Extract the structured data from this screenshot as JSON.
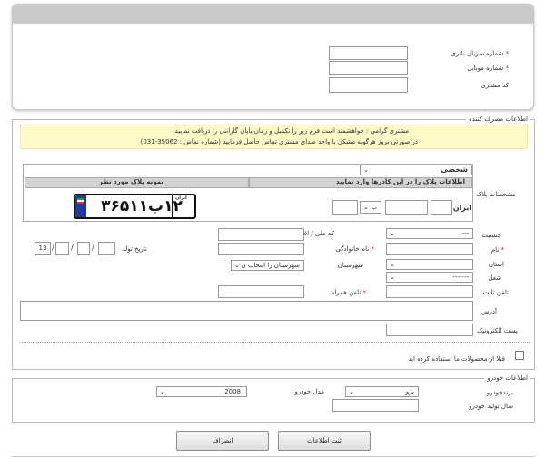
{
  "battery": {
    "serial_label": "شماره سریال باتری",
    "mobile_label": "شماره موبایل",
    "customer_code_label": "کد مشتری",
    "required_mark": "*"
  },
  "consumer": {
    "legend": "اطلاعات مصرف کننده",
    "notice_line1": "مشتری گرامی : خواهشمند است فرم زیر را تکمیل و زمان پایان گارانتی را دریافت نمایید",
    "notice_line2": "در صورتی بروز هرگونه مشکل با واحد صدای مشتری تماس حاصل فرمایید (شماره تماس : 35062-031)",
    "plate_label": "مشخصات پلاک",
    "plate_type": "شخصی",
    "plate_entry_header": "اطلاعات پلاک را در این کادرها وارد نمایید",
    "plate_sample_header": "نمونه پلاک مورد نظر",
    "iran_label": "ایران",
    "plate_letter": "ب",
    "sample_plate": "۱۲ب۳۶۵۱۱",
    "sample_plate_region": "ایران",
    "gender_label": "جنسیت",
    "gender_value": "---",
    "national_code_label": "کد ملی / اقتصادی",
    "name_label": "نام",
    "family_label": "نام خانوادگی",
    "birth_label": "تاریخ تولد",
    "birth_year_prefix": "13",
    "province_label": "استان",
    "city_label": "شهرستان",
    "city_value": "شهرستان را انتخاب ن",
    "job_label": "شغل",
    "job_value": "-------",
    "phone_label": "تلفن ثابت",
    "mobile_label": "تلفن همراه",
    "address_label": "آدرس",
    "email_label": "پست الکترونیک",
    "used_before_label": "قبلا از محصولات ما استفاده کرده اید"
  },
  "vehicle": {
    "legend": "اطلاعات خودرو",
    "brand_label": "برندخودرو",
    "brand_value": "پژو",
    "model_label": "مدل خودرو",
    "model_value": "2008",
    "year_label": "سال تولید خودرو"
  },
  "actions": {
    "submit_label": "ثبت اطلاعات",
    "cancel_label": "انصراف"
  }
}
